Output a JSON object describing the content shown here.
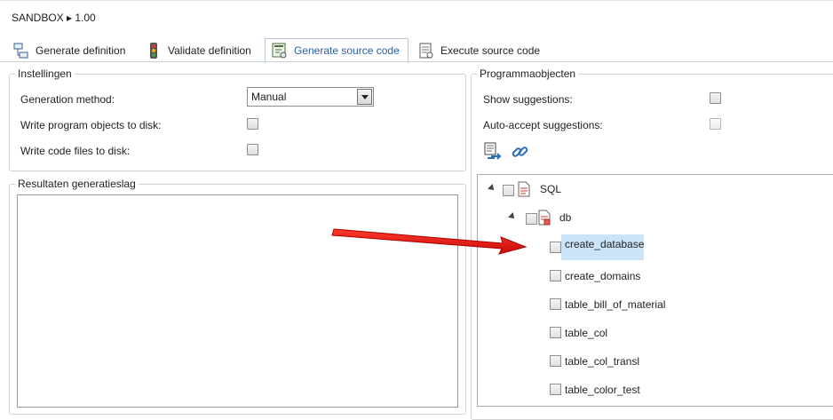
{
  "window": {
    "title": "SANDBOX ▸ 1.00"
  },
  "tabs": [
    {
      "label": "Generate definition",
      "icon": "generate-definition-icon",
      "active": false
    },
    {
      "label": "Validate definition",
      "icon": "traffic-light-icon",
      "active": false
    },
    {
      "label": "Generate source code",
      "icon": "generate-code-icon",
      "active": true
    },
    {
      "label": "Execute source code",
      "icon": "execute-script-icon",
      "active": false
    }
  ],
  "settings": {
    "legend": "Instellingen",
    "generation_method": {
      "label": "Generation method:",
      "value": "Manual"
    },
    "write_program_objects": {
      "label": "Write program objects to disk:",
      "checked": false
    },
    "write_code_files": {
      "label": "Write code files to disk:",
      "checked": false
    }
  },
  "results": {
    "legend": "Resultaten generatieslag"
  },
  "program_objects": {
    "legend": "Programmaobjecten",
    "show_suggestions": {
      "label": "Show suggestions:",
      "checked": false
    },
    "auto_accept": {
      "label": "Auto-accept suggestions:",
      "checked": false
    },
    "toolbar_icons": [
      "import-list-icon",
      "link-icon"
    ],
    "tree": {
      "root": {
        "label": "SQL",
        "expanded": true
      },
      "folder": {
        "label": "db",
        "expanded": true
      },
      "items": [
        {
          "label": "create_database",
          "selected": true
        },
        {
          "label": "create_domains",
          "selected": false
        },
        {
          "label": "table_bill_of_material",
          "selected": false
        },
        {
          "label": "table_col",
          "selected": false
        },
        {
          "label": "table_col_transl",
          "selected": false
        },
        {
          "label": "table_color_test",
          "selected": false
        }
      ]
    }
  },
  "colors": {
    "accent": "#2760a8",
    "selection": "#cce4f7",
    "arrow": "#e01010"
  }
}
